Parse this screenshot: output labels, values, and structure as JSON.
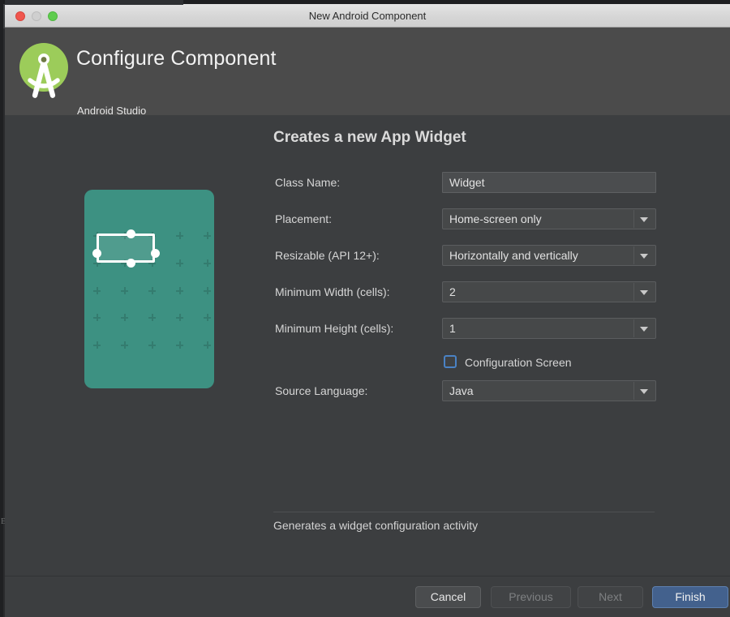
{
  "window": {
    "title": "New Android Component",
    "traffic_lights": [
      "close-button",
      "minimize-button",
      "maximize-button"
    ]
  },
  "header": {
    "title": "Configure Component",
    "subtitle": "Android Studio",
    "logo_icon": "android-studio-logo"
  },
  "main": {
    "pane_title": "Creates a new App Widget",
    "preview": {
      "icon": "app-widget-preview",
      "background_color": "#3d9182",
      "widget_outline_color": "#ffffff",
      "grid_mark_color": "#2d6b60"
    },
    "fields": [
      {
        "label": "Class Name:",
        "type": "text",
        "value": "Widget",
        "placeholder": "",
        "name": "class-name"
      },
      {
        "label": "Placement:",
        "type": "select",
        "value": "Home-screen only",
        "name": "placement"
      },
      {
        "label": "Resizable (API 12+):",
        "type": "select",
        "value": "Horizontally and vertically",
        "name": "resizable"
      },
      {
        "label": "Minimum Width (cells):",
        "type": "select",
        "value": "2",
        "name": "minimum-width"
      },
      {
        "label": "Minimum Height (cells):",
        "type": "select",
        "value": "1",
        "name": "minimum-height"
      },
      {
        "label": "Source Language:",
        "type": "select",
        "value": "Java",
        "name": "source-language"
      }
    ],
    "checkbox": {
      "label": "Configuration Screen",
      "checked": false,
      "focus_color": "#4a82c4"
    },
    "hint": "Generates a widget configuration activity"
  },
  "footer": {
    "buttons": [
      {
        "label": "Cancel",
        "state": "enabled"
      },
      {
        "label": "Previous",
        "state": "disabled"
      },
      {
        "label": "Next",
        "state": "disabled"
      },
      {
        "label": "Finish",
        "state": "primary"
      }
    ]
  },
  "colors": {
    "window_body": "#3c3e40",
    "header_band": "#4b4b4b",
    "titlebar": "#d6d6d6",
    "primary_button": "#43618d",
    "accent": "#4a82c4"
  },
  "artifact": {
    "glyph": "E"
  }
}
